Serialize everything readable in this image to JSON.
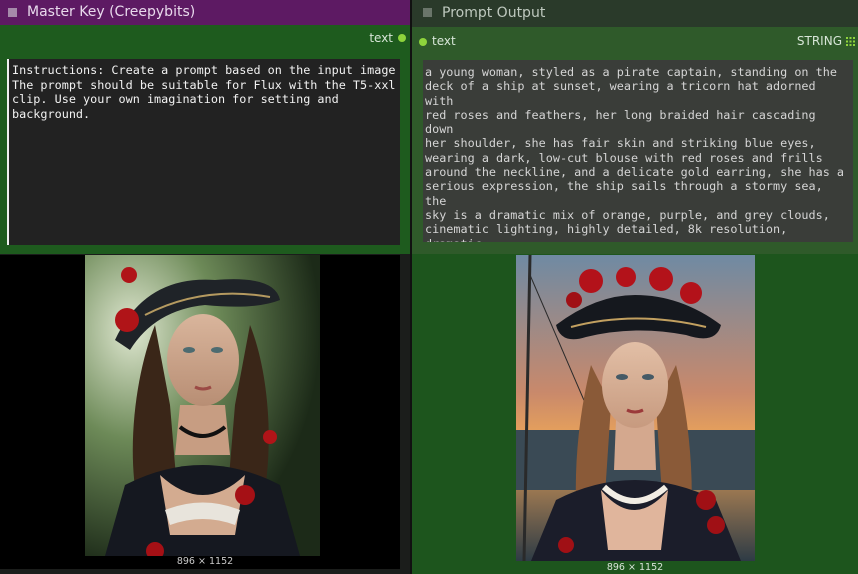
{
  "left_node": {
    "title": "Master Key (Creepybits)",
    "output_label": "text",
    "textarea_value": "Instructions: Create a prompt based on the input image\nThe prompt should be suitable for Flux with the T5-xxl\nclip. Use your own imagination for setting and\nbackground.",
    "image_size": "896 × 1152",
    "header_color": "#5d1a63",
    "body_color": "#1e5b1e"
  },
  "right_node": {
    "title": "Prompt Output",
    "input_label": "text",
    "type_label": "STRING",
    "textarea_value": "a young woman, styled as a pirate captain, standing on the\ndeck of a ship at sunset, wearing a tricorn hat adorned with\nred roses and feathers, her long braided hair cascading down\nher shoulder, she has fair skin and striking blue eyes,\nwearing a dark, low-cut blouse with red roses and frills\naround the neckline, and a delicate gold earring, she has a\nserious expression, the ship sails through a stormy sea, the\nsky is a dramatic mix of orange, purple, and grey clouds,\ncinematic lighting, highly detailed, 8k resolution, dramatic,\n[style], in the style of a Baroque painting",
    "image_size": "896 × 1152",
    "grid_icon": "grid-icon",
    "body_color": "#2f5a2a"
  },
  "connection_dot_color": "#8ed33c"
}
